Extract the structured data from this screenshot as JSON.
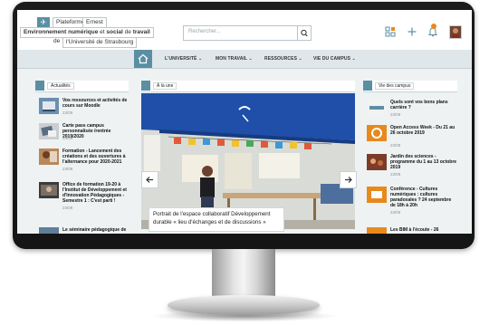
{
  "brand": {
    "plateforme": "Plateforme",
    "ernest": "Ernest",
    "line2_a": "Environnement numérique",
    "line2_b": "et",
    "line2_c": "social",
    "line2_d": "de",
    "line2_e": "travail",
    "line3_prefix": "de",
    "line3_box": "l'Université de Strasbourg"
  },
  "search": {
    "placeholder": "Rechercher..."
  },
  "nav": {
    "items": [
      "L'UNIVERSITÉ",
      "MON TRAVAIL",
      "RESSOURCES",
      "VIE DU CAMPUS"
    ],
    "chevron": "⌄"
  },
  "columns": {
    "left": "Actualités",
    "center": "À la une",
    "right": "Vie des campus"
  },
  "news": [
    {
      "title": "Vos ressources et activités de cours sur Moodle",
      "date": "23/09"
    },
    {
      "title": "Carte pass campus personnalisée /rentrée 2019/2020",
      "date": "23/09"
    },
    {
      "title": "Formation - Lancement des créations et des ouvertures à l'alternance pour 2020-2021",
      "date": "23/09"
    },
    {
      "title": "Office de formation 19-20 à l'Institut de Développement et d'Innovation Pédagogiques - Semestre 1 : C'est parti !",
      "date": "23/09"
    },
    {
      "title": "Le séminaire pédagogique de",
      "date": ""
    }
  ],
  "slider": {
    "caption": "Portrait de l'espace collaboratif Développement durable « lieu d'échanges et de discussions »"
  },
  "campus": [
    {
      "title": "Quels sont vos bons plans carrière ?",
      "date": "23/09"
    },
    {
      "title": "Open Access Week - Du 21 au 26 octobre 2019",
      "date": "23/09"
    },
    {
      "title": "Jardin des sciences - programme du 1 au 13 octobre 2019",
      "date": "23/09"
    },
    {
      "title": "Conférence - Cultures numériques : cultures paradoxales ? 24 septembre de 18h à 20h",
      "date": "23/09"
    },
    {
      "title": "Les BIM à l'écoute - 26",
      "date": ""
    }
  ],
  "colors": {
    "accent": "#5a8fa3",
    "orange": "#e8891c",
    "tent": "#1f4fa8"
  },
  "icons": [
    "logo-icon",
    "search-icon",
    "apps-icon",
    "plus-icon",
    "bell-icon",
    "home-icon",
    "news-icon",
    "calendar-icon",
    "arrow-left-icon",
    "arrow-right-icon"
  ]
}
